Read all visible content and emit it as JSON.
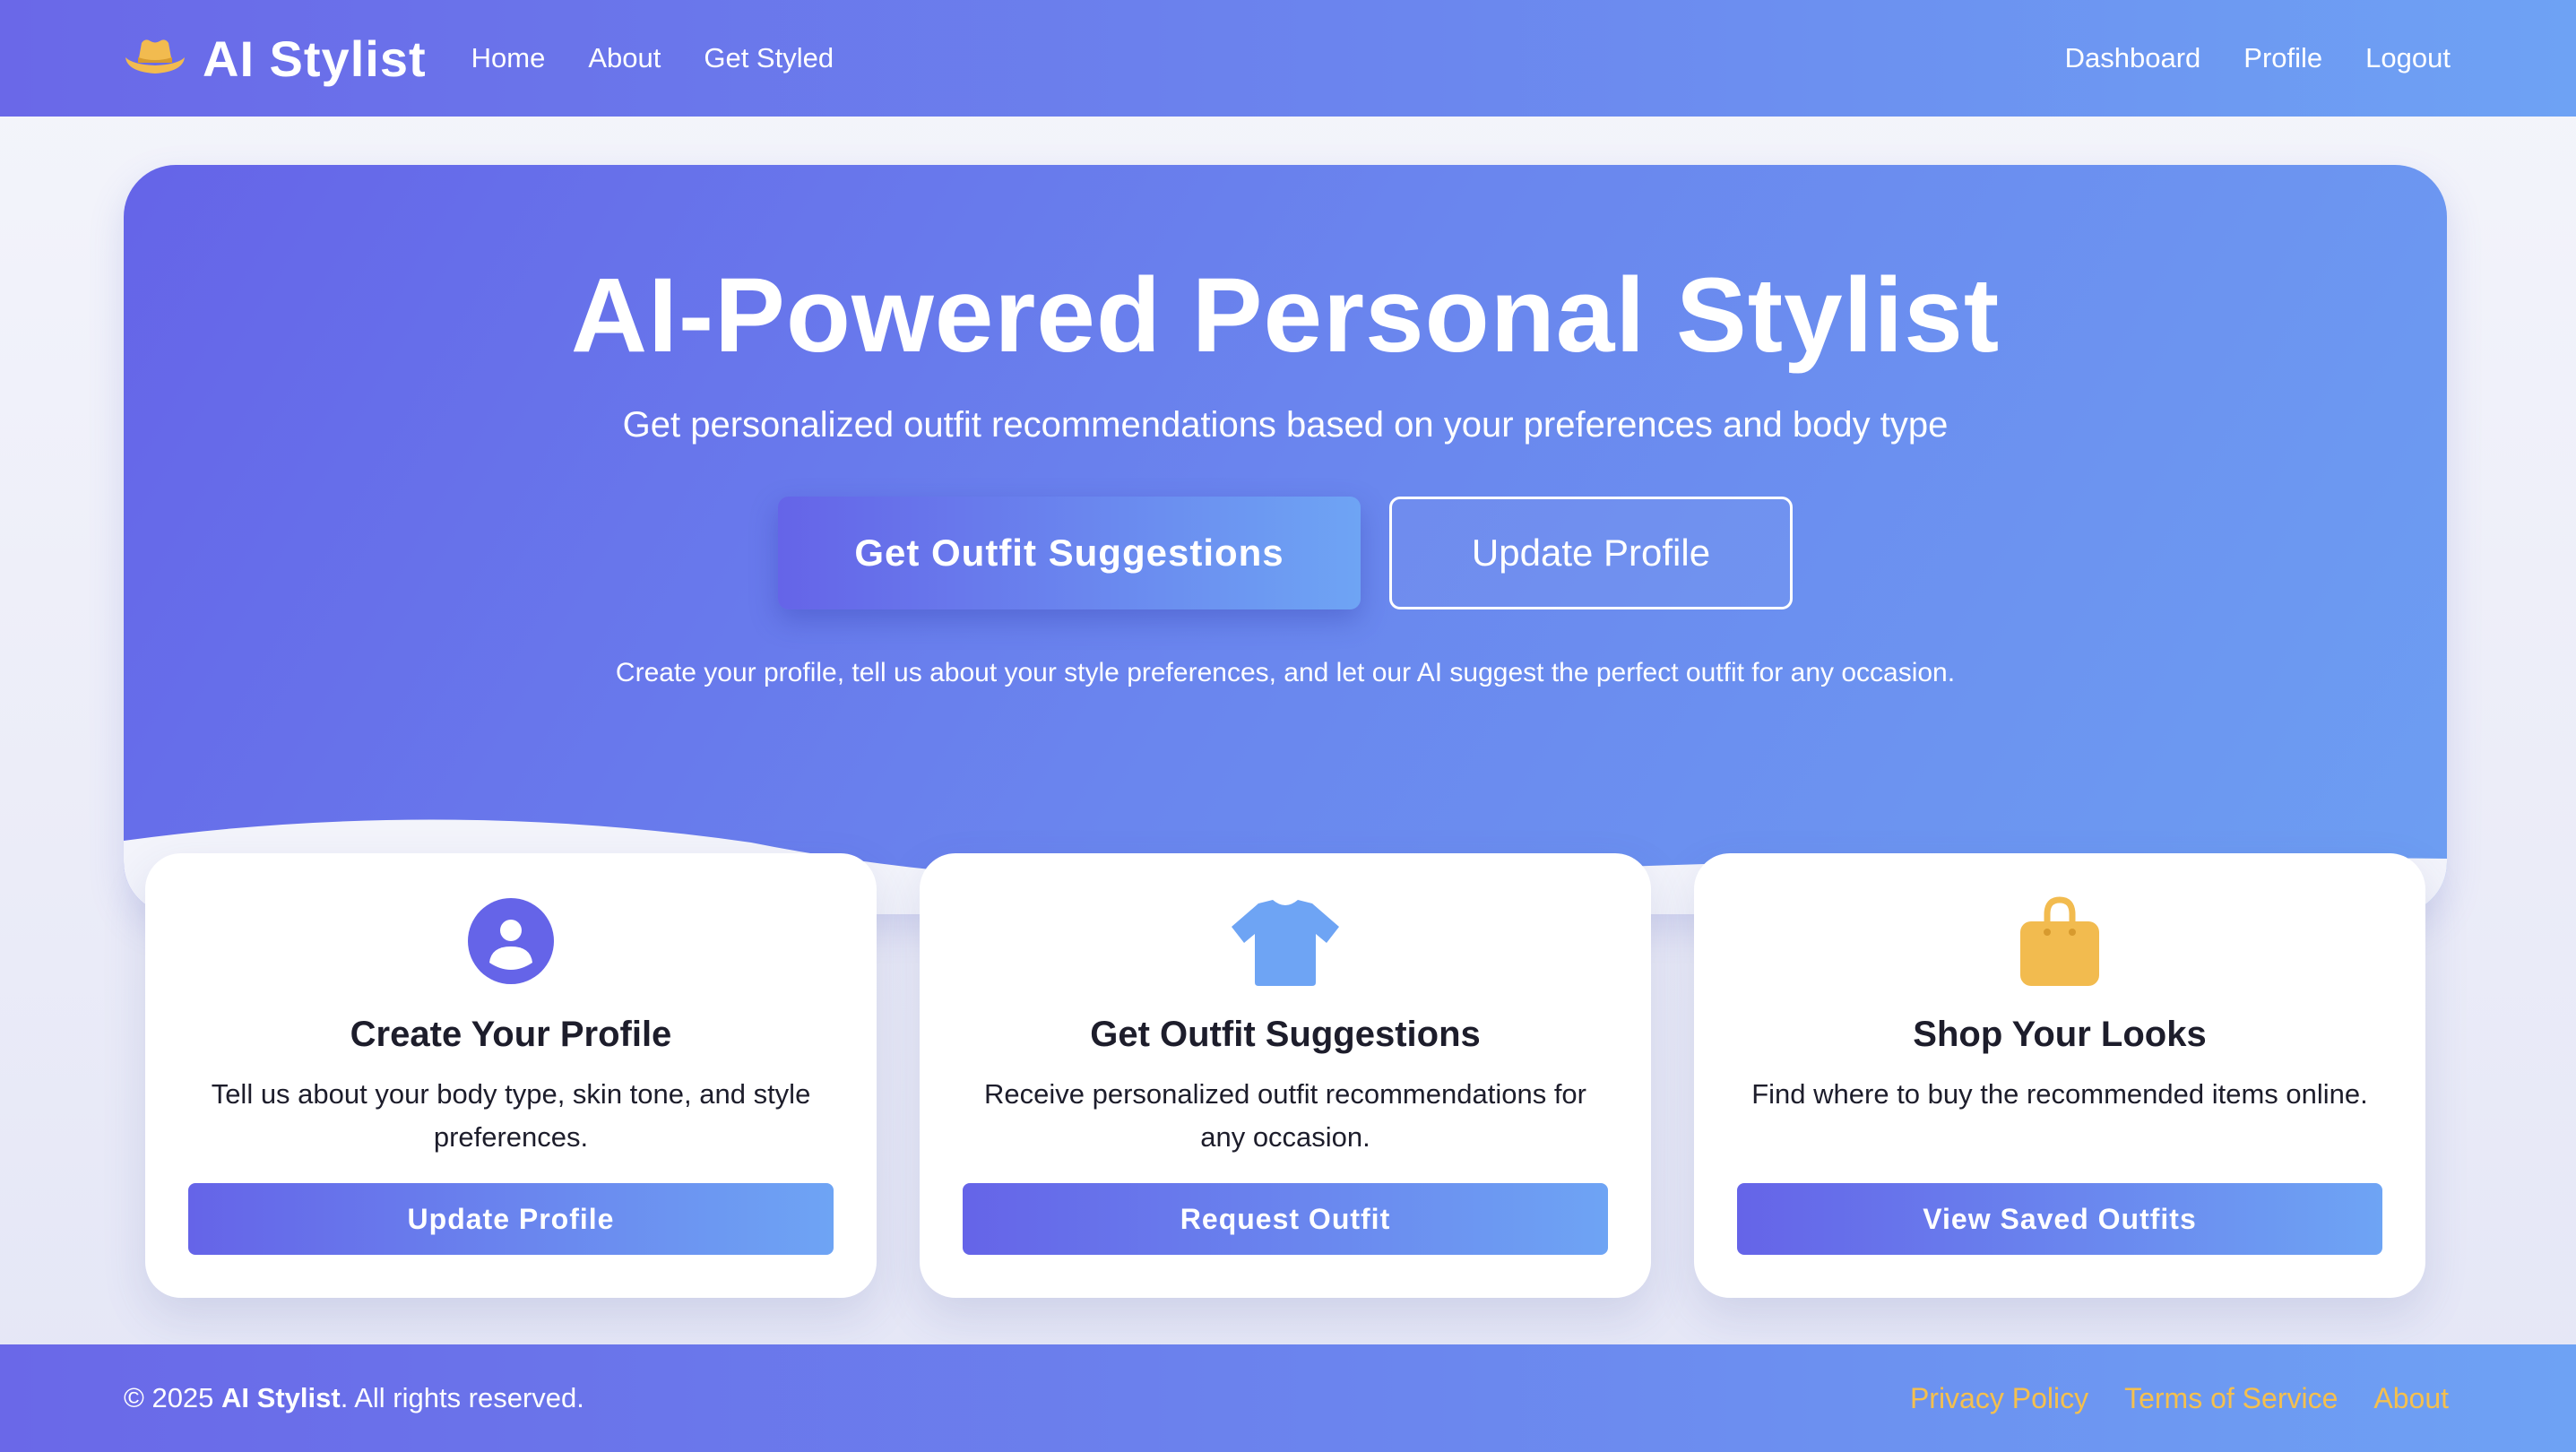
{
  "brand": {
    "name": "AI Stylist",
    "icon": "cowboy-hat-icon",
    "icon_color": "#f2bb4f"
  },
  "nav": {
    "left": [
      "Home",
      "About",
      "Get Styled"
    ],
    "right": [
      "Dashboard",
      "Profile",
      "Logout"
    ]
  },
  "hero": {
    "title": "AI-Powered Personal Stylist",
    "subtitle": "Get personalized outfit recommendations based on your preferences and body type",
    "primary_button": "Get Outfit Suggestions",
    "secondary_button": "Update Profile",
    "note": "Create your profile, tell us about your style preferences, and let our AI suggest the perfect outfit for any occasion."
  },
  "cards": [
    {
      "icon": "user-profile-icon",
      "icon_color": "#6564e8",
      "title": "Create Your Profile",
      "text": "Tell us about your body type, skin tone, and style preferences.",
      "button": "Update Profile"
    },
    {
      "icon": "tshirt-icon",
      "icon_color": "#6ea4f4",
      "title": "Get Outfit Suggestions",
      "text": "Receive personalized outfit recommendations for any occasion.",
      "button": "Request Outfit"
    },
    {
      "icon": "shopping-bag-icon",
      "icon_color": "#f2bb4f",
      "title": "Shop Your Looks",
      "text": "Find where to buy the recommended items online.",
      "button": "View Saved Outfits"
    }
  ],
  "footer": {
    "copyright_prefix": "© 2025 ",
    "copyright_brand": "AI Stylist",
    "copyright_suffix": ". All rights reserved.",
    "links": [
      "Privacy Policy",
      "Terms of Service",
      "About"
    ]
  },
  "colors": {
    "gradient_start": "#6564e8",
    "gradient_end": "#6ea4f4",
    "accent": "#f5c04e"
  }
}
